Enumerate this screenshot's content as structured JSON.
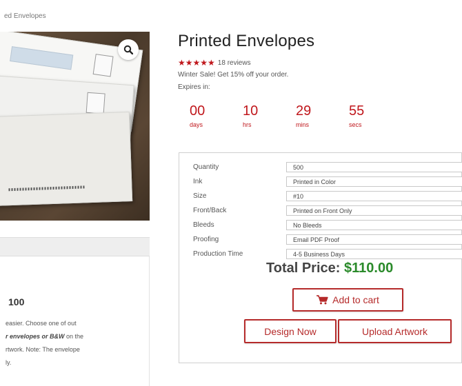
{
  "breadcrumb": "ed Envelopes",
  "product": {
    "title": "Printed Envelopes",
    "rating": {
      "stars": "★★★★★",
      "reviews": "18 reviews"
    },
    "promo": "Winter Sale! Get 15% off your order.",
    "expires_label": "Expires in:"
  },
  "countdown": [
    {
      "value": "00",
      "unit": "days"
    },
    {
      "value": "10",
      "unit": "hrs"
    },
    {
      "value": "29",
      "unit": "mins"
    },
    {
      "value": "55",
      "unit": "secs"
    }
  ],
  "options": [
    {
      "label": "Quantity",
      "value": "500"
    },
    {
      "label": "Ink",
      "value": "Printed in Color"
    },
    {
      "label": "Size",
      "value": "#10"
    },
    {
      "label": "Front/Back",
      "value": "Printed on Front Only"
    },
    {
      "label": "Bleeds",
      "value": "No Bleeds"
    },
    {
      "label": "Proofing",
      "value": "Email PDF Proof"
    },
    {
      "label": "Production Time",
      "value": "4-5 Business Days"
    }
  ],
  "total": {
    "label": "Total Price:",
    "amount": "$110.00"
  },
  "buttons": {
    "add_to_cart": "Add to cart",
    "design_now": "Design Now",
    "upload_artwork": "Upload Artwork"
  },
  "description": {
    "title": "100",
    "line1": "easier. Choose one of out",
    "line2_bold": "r envelopes or B&W",
    "line2_rest": " on the",
    "line3": "rtwork. Note: The envelope",
    "line4": "ly."
  },
  "colors": {
    "accent": "#c0171c",
    "price": "#2a8a2a",
    "button_border": "#b52a2a"
  }
}
